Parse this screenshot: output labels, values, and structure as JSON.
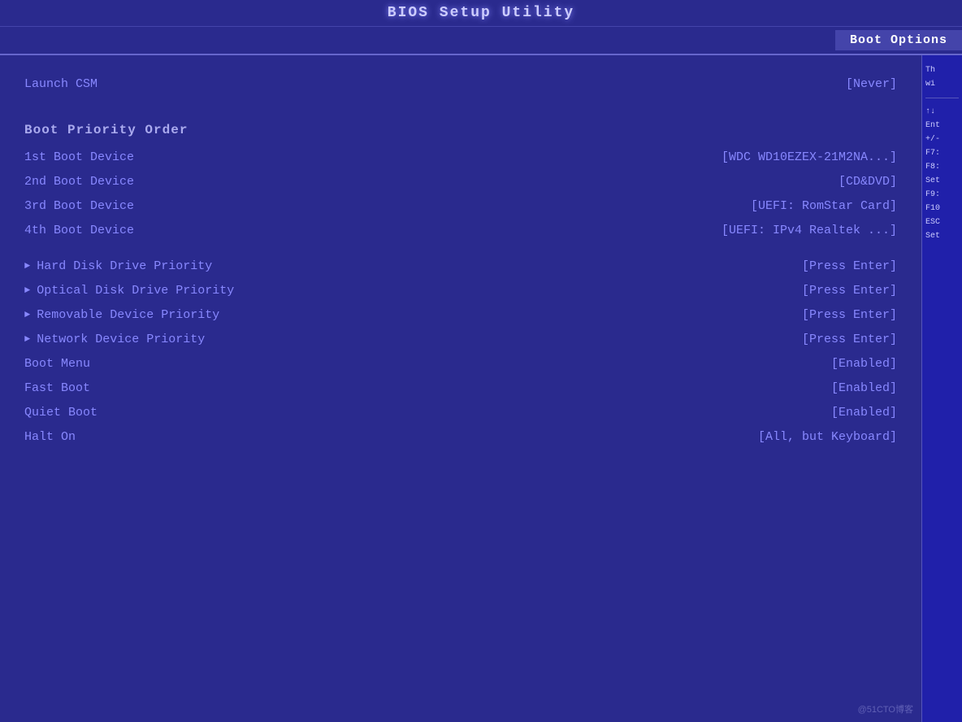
{
  "header": {
    "title": "BIOS Setup Utility"
  },
  "tabs": [
    {
      "label": "Boot Options",
      "active": true
    }
  ],
  "launch_csm": {
    "label": "Launch CSM",
    "value": "[Never]"
  },
  "boot_priority": {
    "section_label": "Boot Priority Order",
    "devices": [
      {
        "label": "1st Boot Device",
        "value": "[WDC WD10EZEX-21M2NA...]"
      },
      {
        "label": "2nd Boot Device",
        "value": "[CD&DVD]"
      },
      {
        "label": "3rd Boot Device",
        "value": "[UEFI: RomStar Card]"
      },
      {
        "label": "4th Boot Device",
        "value": "[UEFI: IPv4 Realtek ...]"
      }
    ]
  },
  "priority_items": [
    {
      "label": "Hard Disk Drive Priority",
      "value": "[Press Enter]",
      "arrow": true
    },
    {
      "label": "Optical Disk Drive Priority",
      "value": "[Press Enter]",
      "arrow": true
    },
    {
      "label": "Removable Device Priority",
      "value": "[Press Enter]",
      "arrow": true
    },
    {
      "label": "Network Device Priority",
      "value": "[Press Enter]",
      "arrow": true
    },
    {
      "label": "Boot Menu",
      "value": "[Enabled]",
      "arrow": false
    },
    {
      "label": "Fast Boot",
      "value": "[Enabled]",
      "arrow": false
    },
    {
      "label": "Quiet Boot",
      "value": "[Enabled]",
      "arrow": false
    },
    {
      "label": "Halt On",
      "value": "[All, but Keyboard]",
      "arrow": false
    }
  ],
  "sidebar": {
    "keys": [
      "↑↓",
      "Ent",
      "+/-",
      "F7:",
      "F8:",
      "Set",
      "F9:",
      "F10",
      "ESC",
      "Set"
    ]
  },
  "watermark": "@51CTO博客"
}
